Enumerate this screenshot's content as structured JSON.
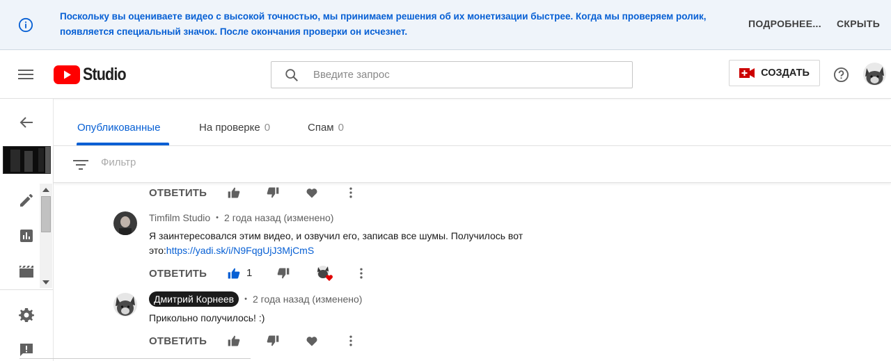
{
  "banner": {
    "message": "Поскольку вы оцениваете видео с высокой точностью, мы принимаем решения об их монетизации быстрее. Когда мы проверяем ролик, появляется специальный значок. После окончания проверки он исчезнет.",
    "more_label": "ПОДРОБНЕЕ...",
    "hide_label": "СКРЫТЬ"
  },
  "header": {
    "logo_text": "Studio",
    "search_placeholder": "Введите запрос",
    "create_label": "СОЗДАТЬ"
  },
  "tabs": [
    {
      "label": "Опубликованные",
      "count": ""
    },
    {
      "label": "На проверке",
      "count": "0"
    },
    {
      "label": "Спам",
      "count": "0"
    }
  ],
  "filter": {
    "placeholder": "Фильтр"
  },
  "comments": [
    {
      "reply_label": "ОТВЕТИТЬ"
    },
    {
      "author": "Timfilm Studio",
      "time": "2 года назад (изменено)",
      "text": "Я заинтересовался этим видео, и озвучил его, записав все шумы. Получилось вот это:",
      "link": "https://yadi.sk/i/N9FqgUjJ3MjCmS",
      "reply_label": "ОТВЕТИТЬ",
      "likes": "1"
    },
    {
      "author": "Дмитрий Корнеев",
      "time": "2 года назад (изменено)",
      "text": "Прикольно получилось! :)",
      "reply_label": "ОТВЕТИТЬ"
    }
  ],
  "colors": {
    "accent": "#065fd4",
    "brand_red": "#ff0000",
    "banner_bg": "#eff4fa"
  }
}
